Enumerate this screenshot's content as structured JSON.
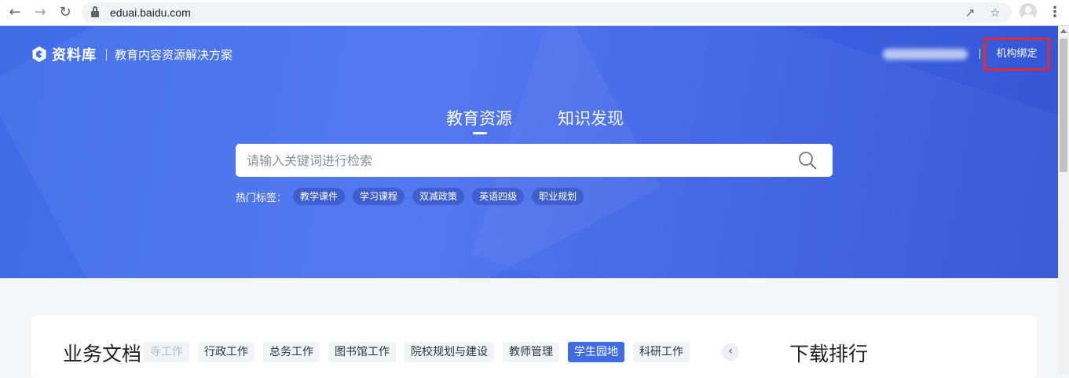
{
  "browser": {
    "url": "eduai.baidu.com",
    "icons": [
      "back-arrow-icon",
      "forward-arrow-icon",
      "reload-icon",
      "lock-icon",
      "share-icon",
      "star-icon",
      "profile-avatar-icon",
      "menu-kebab-icon"
    ]
  },
  "header": {
    "logo_text": "资料库",
    "subtitle": "教育内容资源解决方案",
    "bind_button": "机构绑定"
  },
  "hero": {
    "tabs": [
      {
        "label": "教育资源",
        "active": true
      },
      {
        "label": "知识发现",
        "active": false
      }
    ],
    "search_placeholder": "请输入关键词进行检索",
    "hot_label": "热门标签：",
    "hot_tags": [
      "教学课件",
      "学习课程",
      "双减政策",
      "英语四级",
      "职业规划"
    ]
  },
  "business_docs": {
    "title": "业务文档",
    "categories": [
      "寺工作",
      "行政工作",
      "总务工作",
      "图书馆工作",
      "院校规划与建设",
      "教师管理",
      "学生园地",
      "科研工作"
    ],
    "active_category": "学生园地"
  },
  "rankings": {
    "title": "下载排行"
  },
  "colors": {
    "hero_blue": "#4a72f0",
    "accent": "#3f6ce6",
    "highlight_box": "#e8282d"
  }
}
